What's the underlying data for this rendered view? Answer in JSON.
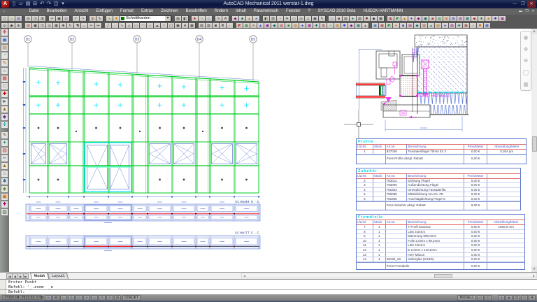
{
  "window": {
    "title": "AutoCAD Mechanical 2011   werstat-1.dwg"
  },
  "qat": [
    {
      "n": "qat-new",
      "g": "▯"
    },
    {
      "n": "qat-open",
      "g": "▱"
    },
    {
      "n": "qat-save",
      "g": "▤"
    },
    {
      "n": "qat-plot",
      "g": "⊟"
    },
    {
      "n": "qat-undo",
      "g": "↶"
    },
    {
      "n": "qat-redo",
      "g": "↷"
    },
    {
      "n": "qat-preview",
      "g": "◫"
    },
    {
      "n": "qat-dropdown",
      "g": "▾"
    }
  ],
  "window_buttons": [
    {
      "n": "minimize",
      "g": "—"
    },
    {
      "n": "maximize",
      "g": "❐"
    },
    {
      "n": "close",
      "g": "✕"
    }
  ],
  "menu": {
    "items": [
      "Datei",
      "Bearbeiten",
      "Ansicht",
      "Einfügen",
      "Format",
      "Extras",
      "Zeichnen",
      "Beschriften",
      "Ändern",
      "Inhalt",
      "Parametrisch",
      "Fenster",
      "?",
      "SYSCAD 2010 Beta",
      "HUECK-HARTMANN"
    ]
  },
  "doc_buttons": [
    {
      "n": "doc-minimize",
      "g": "▬"
    },
    {
      "n": "doc-restore",
      "g": "❐"
    },
    {
      "n": "doc-close",
      "g": "✕"
    }
  ],
  "toolbar1": [
    {
      "n": "new",
      "g": "▯",
      "c": "#333"
    },
    {
      "n": "open",
      "g": "▱",
      "c": "#a80"
    },
    {
      "n": "save",
      "g": "▤",
      "c": "#33c"
    },
    "|",
    {
      "n": "plot",
      "g": "⊟",
      "c": "#333"
    },
    {
      "n": "plot-preview",
      "g": "◫",
      "c": "#333"
    },
    {
      "n": "publish",
      "g": "▥",
      "c": "#333"
    },
    "|",
    {
      "n": "cut",
      "g": "✂",
      "c": "#333"
    },
    {
      "n": "copy-clip",
      "g": "▣",
      "c": "#333"
    },
    {
      "n": "paste",
      "g": "▨",
      "c": "#86a"
    },
    "|",
    {
      "n": "undo",
      "g": "↶",
      "c": "#36c"
    },
    {
      "n": "redo",
      "g": "↷",
      "c": "#36c"
    },
    "|",
    {
      "n": "sheetset",
      "g": "▥",
      "c": "#963"
    },
    {
      "n": "markup",
      "g": "✎",
      "c": "#333"
    },
    "|",
    {
      "n": "layer-properties",
      "g": "✦",
      "c": "#c90"
    },
    {
      "n": "layer-states",
      "g": "✱",
      "c": "#c90"
    },
    "COMBO",
    "|",
    {
      "n": "match-props",
      "g": "▨",
      "c": "#333"
    },
    {
      "n": "properties",
      "g": "◧",
      "c": "#333"
    },
    "|",
    {
      "n": "tool-a",
      "g": "✚",
      "c": "#c33"
    },
    {
      "n": "tool-b",
      "g": "◔",
      "c": "#363"
    },
    {
      "n": "tool-c",
      "g": "◇",
      "c": "#36c"
    },
    "|",
    {
      "n": "tool-d",
      "g": "✎",
      "c": "#633"
    },
    {
      "n": "tool-e",
      "g": "A",
      "c": "#333"
    },
    "|",
    {
      "n": "tool-f",
      "g": "◆",
      "c": "#909"
    },
    {
      "n": "tool-g",
      "g": "■",
      "c": "#066"
    },
    {
      "n": "tool-h",
      "g": "▲",
      "c": "#c60"
    },
    {
      "n": "tool-i",
      "g": "●",
      "c": "#36c"
    },
    "|",
    {
      "n": "tool-j",
      "g": "◧",
      "c": "#333"
    },
    {
      "n": "tool-k",
      "g": "▥",
      "c": "#333"
    },
    {
      "n": "tool-l",
      "g": "◔",
      "c": "#633"
    },
    {
      "n": "tool-m",
      "g": "✚",
      "c": "#366"
    },
    {
      "n": "tool-n",
      "g": "▭",
      "c": "#333"
    },
    {
      "n": "tool-o",
      "g": "◎",
      "c": "#333"
    },
    {
      "n": "tool-p",
      "g": "△",
      "c": "#633"
    },
    {
      "n": "tool-q",
      "g": "▣",
      "c": "#336"
    },
    {
      "n": "tool-r",
      "g": "✎",
      "c": "#333"
    },
    "|",
    {
      "n": "tool-s",
      "g": "◇",
      "c": "#36c"
    },
    {
      "n": "tool-t",
      "g": "■",
      "c": "#633"
    },
    {
      "n": "tool-u",
      "g": "▤",
      "c": "#333"
    },
    {
      "n": "tool-v",
      "g": "●",
      "c": "#066"
    },
    {
      "n": "tool-w",
      "g": "▨",
      "c": "#333"
    },
    {
      "n": "tool-x",
      "g": "✱",
      "c": "#633"
    },
    {
      "n": "tool-y",
      "g": "◆",
      "c": "#336"
    },
    {
      "n": "tool-z",
      "g": "▩",
      "c": "#333"
    },
    "|",
    {
      "n": "sys-1",
      "g": "▦",
      "c": "#b33"
    },
    {
      "n": "sys-2",
      "g": "◩",
      "c": "#283"
    },
    {
      "n": "sys-3",
      "g": "▲",
      "c": "#c60"
    },
    {
      "n": "sys-4",
      "g": "✦",
      "c": "#33c"
    },
    {
      "n": "sys-5",
      "g": "◆",
      "c": "#909"
    },
    {
      "n": "sys-6",
      "g": "▣",
      "c": "#066"
    },
    {
      "n": "sys-7",
      "g": "■",
      "c": "#a33"
    },
    {
      "n": "sys-8",
      "g": "▤",
      "c": "#283"
    },
    {
      "n": "sys-9",
      "g": "▥",
      "c": "#c60"
    },
    {
      "n": "sys-10",
      "g": "▧",
      "c": "#33c"
    },
    {
      "n": "sys-11",
      "g": "▨",
      "c": "#909"
    },
    {
      "n": "sys-12",
      "g": "▩",
      "c": "#066"
    },
    {
      "n": "sys-13",
      "g": "◆",
      "c": "#a33"
    },
    {
      "n": "sys-14",
      "g": "✚",
      "c": "#283"
    },
    {
      "n": "sys-15",
      "g": "●",
      "c": "#c60"
    },
    {
      "n": "sys-16",
      "g": "✱",
      "c": "#33c"
    },
    {
      "n": "sys-17",
      "g": "▦",
      "c": "#909"
    }
  ],
  "toolbar2": [
    {
      "n": "zoom-window",
      "g": "◎",
      "c": "#333"
    },
    {
      "n": "zoom-previous",
      "g": "◉",
      "c": "#333"
    },
    {
      "n": "zoom-realtime",
      "g": "⊕",
      "c": "#333"
    },
    "|",
    {
      "n": "erase",
      "g": "▨",
      "c": "#c33"
    },
    {
      "n": "copy",
      "g": "▣",
      "c": "#333"
    },
    {
      "n": "mirror",
      "g": "◫",
      "c": "#333"
    },
    {
      "n": "offset",
      "g": "◎",
      "c": "#333"
    },
    {
      "n": "array",
      "g": "▦",
      "c": "#333"
    },
    {
      "n": "move",
      "g": "✥",
      "c": "#333"
    },
    {
      "n": "rotate",
      "g": "↻",
      "c": "#333"
    },
    {
      "n": "scale",
      "g": "◥",
      "c": "#333"
    },
    {
      "n": "stretch",
      "g": "↔",
      "c": "#333"
    },
    {
      "n": "trim",
      "g": "✂",
      "c": "#333"
    },
    {
      "n": "extend",
      "g": "↦",
      "c": "#333"
    },
    "|",
    {
      "n": "line",
      "g": "╱",
      "c": "#333"
    },
    {
      "n": "xline",
      "g": "⋰",
      "c": "#333"
    },
    {
      "n": "polyline",
      "g": "∿",
      "c": "#333"
    },
    {
      "n": "polygon",
      "g": "△",
      "c": "#333"
    },
    {
      "n": "rectangle",
      "g": "▭",
      "c": "#333"
    },
    {
      "n": "arc",
      "g": "◠",
      "c": "#333"
    },
    {
      "n": "circle",
      "g": "○",
      "c": "#333"
    },
    {
      "n": "revcloud",
      "g": "☁",
      "c": "#333"
    },
    {
      "n": "spline",
      "g": "~",
      "c": "#333"
    },
    {
      "n": "ellipse",
      "g": "◯",
      "c": "#333"
    },
    {
      "n": "insert-block",
      "g": "▣",
      "c": "#333"
    },
    {
      "n": "text",
      "g": "A",
      "c": "#333"
    },
    {
      "n": "table",
      "g": "▦",
      "c": "#333"
    },
    "|",
    {
      "n": "hatch",
      "g": "▨",
      "c": "#333"
    },
    {
      "n": "gradient",
      "g": "▧",
      "c": "#333"
    },
    {
      "n": "region",
      "g": "◙",
      "c": "#333"
    },
    {
      "n": "multiline",
      "g": "≣",
      "c": "#333"
    },
    {
      "n": "point",
      "g": "·",
      "c": "#333"
    },
    "|",
    {
      "n": "sys2-1",
      "g": "◩",
      "c": "#b33"
    },
    {
      "n": "sys2-2",
      "g": "▦",
      "c": "#283"
    },
    {
      "n": "sys2-3",
      "g": "✦",
      "c": "#c60"
    },
    {
      "n": "sys2-4",
      "g": "▲",
      "c": "#33c"
    },
    {
      "n": "sys2-5",
      "g": "▣",
      "c": "#909"
    },
    {
      "n": "sys2-6",
      "g": "◆",
      "c": "#066"
    },
    {
      "n": "sys2-7",
      "g": "▤",
      "c": "#a33"
    },
    {
      "n": "sys2-8",
      "g": "■",
      "c": "#283"
    },
    {
      "n": "sys2-9",
      "g": "▧",
      "c": "#c60"
    },
    {
      "n": "sys2-10",
      "g": "●",
      "c": "#33c"
    },
    {
      "n": "sys2-11",
      "g": "▩",
      "c": "#909"
    },
    {
      "n": "sys2-12",
      "g": "✚",
      "c": "#066"
    },
    {
      "n": "sys2-13",
      "g": "▥",
      "c": "#a33"
    },
    {
      "n": "sys2-14",
      "g": "◔",
      "c": "#283"
    },
    {
      "n": "sys2-15",
      "g": "▨",
      "c": "#c60"
    },
    {
      "n": "sys2-16",
      "g": "✱",
      "c": "#33c"
    },
    {
      "n": "sys2-17",
      "g": "◆",
      "c": "#909"
    },
    {
      "n": "sys2-18",
      "g": "▦",
      "c": "#066"
    },
    {
      "n": "sys2-19",
      "g": "▲",
      "c": "#a33"
    },
    "|",
    {
      "n": "sys3-1",
      "g": "▣",
      "c": "#36c"
    },
    {
      "n": "sys3-2",
      "g": "▦",
      "c": "#a33"
    },
    {
      "n": "sys3-3",
      "g": "◩",
      "c": "#283"
    },
    {
      "n": "sys3-4",
      "g": "✦",
      "c": "#c60"
    },
    {
      "n": "sys3-5",
      "g": "■",
      "c": "#33c"
    },
    {
      "n": "sys3-6",
      "g": "▤",
      "c": "#909"
    },
    {
      "n": "sys3-7",
      "g": "◆",
      "c": "#066"
    },
    {
      "n": "sys3-8",
      "g": "▥",
      "c": "#a33"
    },
    {
      "n": "sys3-9",
      "g": "▲",
      "c": "#283"
    },
    {
      "n": "sys3-10",
      "g": "▧",
      "c": "#c60"
    },
    {
      "n": "sys3-11",
      "g": "●",
      "c": "#33c"
    },
    {
      "n": "sys3-12",
      "g": "▨",
      "c": "#909"
    },
    {
      "n": "sys3-13",
      "g": "✚",
      "c": "#066"
    },
    {
      "n": "sys3-14",
      "g": "▩",
      "c": "#a33"
    },
    {
      "n": "sys3-15",
      "g": "◔",
      "c": "#283"
    },
    {
      "n": "sys3-16",
      "g": "✱",
      "c": "#c60"
    },
    {
      "n": "sys3-17",
      "g": "▦",
      "c": "#33c"
    }
  ],
  "layer_combo": {
    "value": "Schnittkanten",
    "color": "#007a00"
  },
  "left_toolbar": [
    {
      "n": "palette-1",
      "g": "✥",
      "c": "#c33"
    },
    {
      "n": "palette-2",
      "g": "▣",
      "c": "#36c"
    },
    {
      "n": "palette-3",
      "g": "▤",
      "c": "#963"
    },
    {
      "n": "palette-4",
      "g": "◔",
      "c": "#396"
    },
    {
      "n": "palette-5",
      "g": "✎",
      "c": "#c60"
    },
    {
      "n": "palette-6",
      "g": "⌂",
      "c": "#36a"
    },
    {
      "n": "palette-7",
      "g": "▦",
      "c": "#c33"
    },
    {
      "n": "palette-8",
      "g": "□",
      "c": "#333"
    },
    {
      "n": "palette-9",
      "g": "✚",
      "c": "#c00"
    },
    {
      "n": "palette-10",
      "g": "►",
      "c": "#369"
    },
    {
      "n": "palette-11",
      "g": "▲",
      "c": "#960"
    },
    {
      "n": "palette-12",
      "g": "◆",
      "c": "#639"
    },
    {
      "n": "palette-13",
      "g": "✣",
      "c": "#099"
    },
    {
      "n": "palette-14",
      "g": "✎",
      "c": "#842"
    },
    {
      "n": "palette-15",
      "g": "✦",
      "c": "#286"
    },
    {
      "n": "palette-16",
      "g": "▧",
      "c": "#c33"
    },
    {
      "n": "palette-17",
      "g": "➳",
      "c": "#36c"
    },
    {
      "n": "palette-18",
      "g": "▲",
      "c": "#a60"
    },
    {
      "n": "palette-19",
      "g": "⌂",
      "c": "#933"
    },
    {
      "n": "palette-20",
      "g": "✱",
      "c": "#369"
    },
    {
      "n": "palette-21",
      "g": "◆",
      "c": "#693"
    },
    {
      "n": "palette-22",
      "g": "▣",
      "c": "#c60"
    },
    {
      "n": "palette-23",
      "g": "✚",
      "c": "#906"
    },
    {
      "n": "palette-24",
      "g": "▨",
      "c": "#363"
    }
  ],
  "drawing": {
    "grid_bubbles": [
      "D1",
      "D2",
      "D3",
      "D4",
      "D5"
    ],
    "section_d_label": "SCHNITT  D  -  D",
    "section_c_label": "SCHNITT  C  -  C",
    "anchor_label": "HST  M8x10"
  },
  "tables": [
    {
      "title": "Profile",
      "headers": [
        "Lfd.Nr.",
        "Stück",
        "Art.Nr.",
        "Bezeichnung",
        "Preis/Meter",
        "Abwicklung/Meter"
      ],
      "rows": [
        [
          "1",
          "",
          "837048",
          "Fassadenflügel 70mm für 2",
          "0,00 €",
          "0,304 qm"
        ]
      ],
      "footer": [
        "Preis Profile abzgl.  Rabatt",
        "0,00 €"
      ]
    },
    {
      "title": "Zubehör",
      "headers": [
        "Lfd.Nr.",
        "Stück",
        "Art.Nr.",
        "Bezeichnung",
        "Preis/Meter",
        ""
      ],
      "rows": [
        [
          "2",
          "",
          "783012",
          "Dichtung Flügel",
          "0,00 €",
          ""
        ],
        [
          "3",
          "",
          "793009",
          "Außendichtung Flügel",
          "0,00 €",
          ""
        ],
        [
          "4",
          "",
          "781803",
          "Innendichtung Fassadenflü",
          "0,00 €",
          ""
        ],
        [
          "5",
          "",
          "780088",
          "Mitteldichtung neu Nr. #D",
          "0,00 €",
          ""
        ],
        [
          "6",
          "",
          "781808",
          "Anschlagdichtung Flügel S",
          "0,00 €",
          ""
        ]
      ],
      "footer": [
        "Preis Zubehör abzgl.  Rabatt",
        "0,00 €"
      ]
    },
    {
      "title": "Fremdteile",
      "headers": [
        "Lfd.Nr.",
        "Stück",
        "Art.Nr.",
        "Bezeichnung",
        "Preis/Meter",
        "Abwicklung/Meter"
      ],
      "rows": [
        [
          "7",
          "1",
          "",
          "T-Profil 40x20x2",
          "0,00 €",
          "1000,0 mm"
        ],
        [
          "8",
          "1",
          "",
          "LBS 3,5x9,5",
          "0,00 €",
          ""
        ],
        [
          "9",
          "1",
          "",
          "Dämmung 999,0mm",
          "0,00 €",
          ""
        ],
        [
          "10",
          "1",
          "",
          "Folie 2,0mm x 98,2mm",
          "0,00 €",
          ""
        ],
        [
          "11",
          "1",
          "",
          "LBS 3,5x6,5",
          "0,00 €",
          ""
        ],
        [
          "12",
          "1",
          "",
          "E 2,0mm x 140,5mm",
          "0,00 €",
          ""
        ],
        [
          "13",
          "1",
          "",
          "HST M8x10",
          "0,00 €",
          ""
        ],
        [
          "14",
          "1",
          "ISO28_3X",
          "Isolierglas (5/18/5)",
          "0,00 €",
          ""
        ]
      ],
      "footer": [
        "Preis Fremdteile",
        "0,00 €"
      ]
    }
  ],
  "tabs": {
    "nav": [
      "|◀",
      "◀",
      "▶",
      "▶|"
    ],
    "model": "Model",
    "layout": "Layout1"
  },
  "command": {
    "history": [
      "Erster Punkt",
      "Befehl: '_.zoom  _e"
    ],
    "prompt": "Befehl:"
  },
  "status": {
    "coords": "17302.04, 2913.33, 0.00",
    "toggles": [
      {
        "n": "snap",
        "g": "+",
        "c": "#2f4f8f"
      },
      {
        "n": "grid",
        "g": "▦",
        "c": "#555"
      },
      {
        "n": "ortho",
        "g": "∟",
        "c": "#555"
      },
      {
        "n": "polar",
        "g": "∠",
        "c": "#2f4f8f"
      },
      {
        "n": "osnap",
        "g": "◇",
        "c": "#2f4f8f"
      },
      {
        "n": "otrack",
        "g": "+",
        "c": "#2f4f8f"
      },
      {
        "n": "ducs",
        "g": "△",
        "c": "#555"
      },
      {
        "n": "dyn",
        "g": "✎",
        "c": "#555"
      },
      {
        "n": "lwt",
        "g": "≡",
        "c": "#2f4f8f"
      },
      {
        "n": "qp",
        "g": "▤",
        "c": "#555"
      }
    ],
    "strukt": "STRUKT",
    "modell": "MODELL",
    "right_icons": [
      {
        "n": "paper",
        "g": "▱",
        "c": "#333"
      },
      {
        "n": "maximize-vp",
        "g": "◱",
        "c": "#333"
      }
    ],
    "far_icons": [
      {
        "n": "annot-scale",
        "g": "△",
        "c": "#336"
      },
      {
        "n": "annot-vis",
        "g": "▲",
        "c": "#336"
      },
      {
        "n": "lock",
        "g": "◘",
        "c": "#333"
      },
      {
        "n": "clean",
        "g": "▭",
        "c": "#333"
      },
      {
        "n": "menu-arrow",
        "g": "▾",
        "c": "#222"
      }
    ]
  }
}
